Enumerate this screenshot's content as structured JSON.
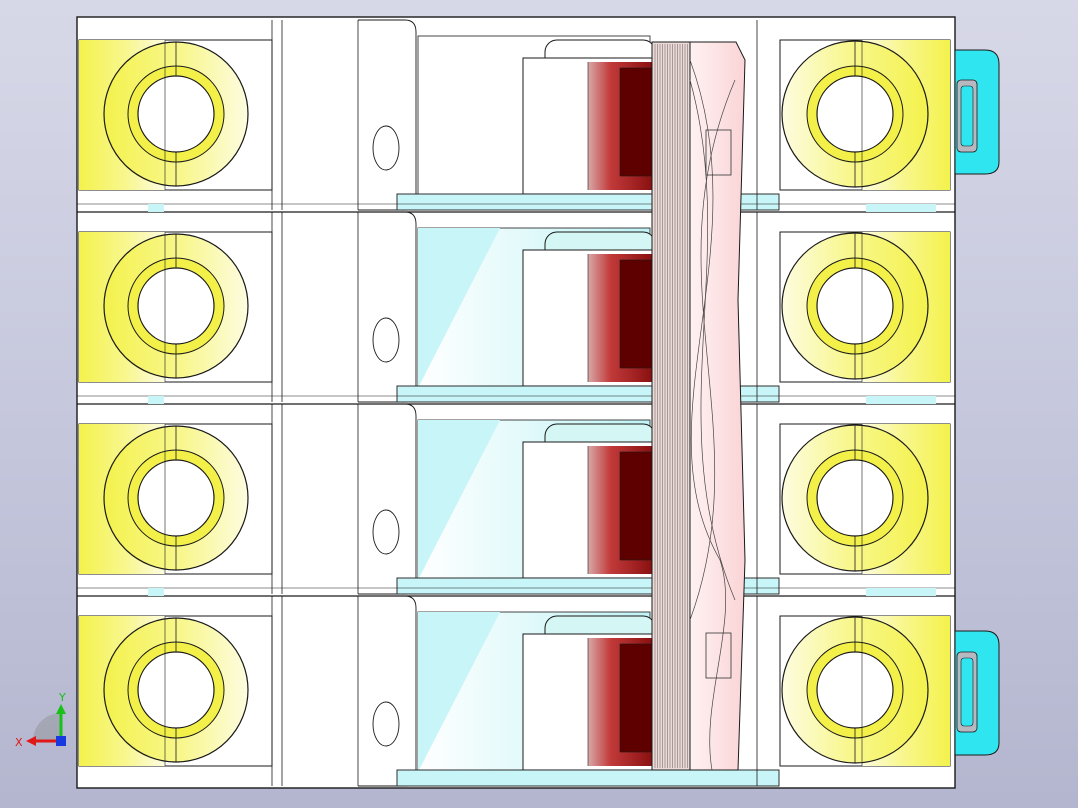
{
  "viewport": {
    "background_top": "#d7d8e7",
    "background_bottom": "#b4b6cf"
  },
  "model": {
    "pole_count": 4,
    "colors": {
      "body_fill": "#ffffff",
      "edge": "#1a1a1a",
      "terminal_yellow": "#f3f04a",
      "terminal_light": "#fbf9b8",
      "cyan_glass": "#c8f5f7",
      "cyan_bright": "#2fe6f0",
      "contact_red": "#b5262a",
      "contact_dark": "#5e0000",
      "bar_pink": "#fcdfe0",
      "arc_plate": "#e8d8d5"
    }
  },
  "triad": {
    "icon": "axis-triad-icon",
    "x_label": "X",
    "y_label": "Y",
    "x_color": "#e01818",
    "y_color": "#18c018",
    "z_color": "#1838e0"
  }
}
